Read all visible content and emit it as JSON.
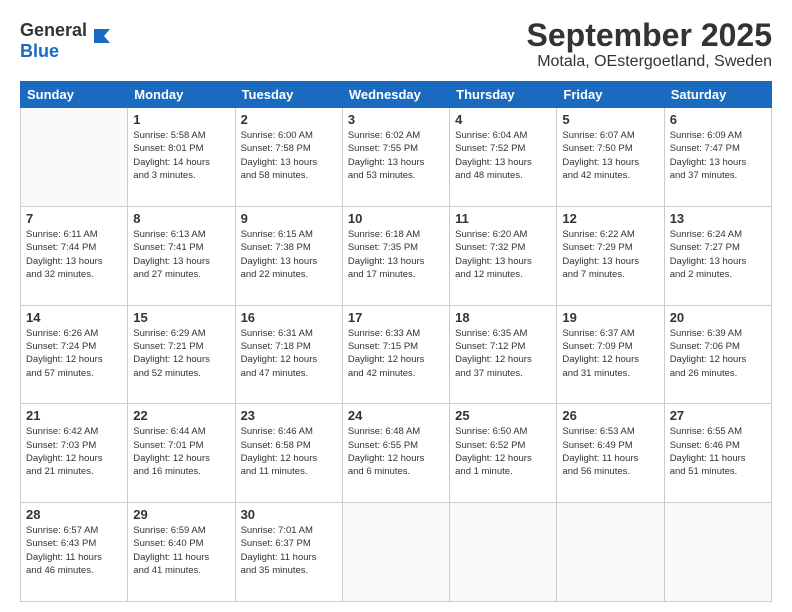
{
  "header": {
    "logo_general": "General",
    "logo_blue": "Blue",
    "title": "September 2025",
    "subtitle": "Motala, OEstergoetland, Sweden"
  },
  "days_of_week": [
    "Sunday",
    "Monday",
    "Tuesday",
    "Wednesday",
    "Thursday",
    "Friday",
    "Saturday"
  ],
  "weeks": [
    [
      {
        "day": "",
        "info": ""
      },
      {
        "day": "1",
        "info": "Sunrise: 5:58 AM\nSunset: 8:01 PM\nDaylight: 14 hours\nand 3 minutes."
      },
      {
        "day": "2",
        "info": "Sunrise: 6:00 AM\nSunset: 7:58 PM\nDaylight: 13 hours\nand 58 minutes."
      },
      {
        "day": "3",
        "info": "Sunrise: 6:02 AM\nSunset: 7:55 PM\nDaylight: 13 hours\nand 53 minutes."
      },
      {
        "day": "4",
        "info": "Sunrise: 6:04 AM\nSunset: 7:52 PM\nDaylight: 13 hours\nand 48 minutes."
      },
      {
        "day": "5",
        "info": "Sunrise: 6:07 AM\nSunset: 7:50 PM\nDaylight: 13 hours\nand 42 minutes."
      },
      {
        "day": "6",
        "info": "Sunrise: 6:09 AM\nSunset: 7:47 PM\nDaylight: 13 hours\nand 37 minutes."
      }
    ],
    [
      {
        "day": "7",
        "info": "Sunrise: 6:11 AM\nSunset: 7:44 PM\nDaylight: 13 hours\nand 32 minutes."
      },
      {
        "day": "8",
        "info": "Sunrise: 6:13 AM\nSunset: 7:41 PM\nDaylight: 13 hours\nand 27 minutes."
      },
      {
        "day": "9",
        "info": "Sunrise: 6:15 AM\nSunset: 7:38 PM\nDaylight: 13 hours\nand 22 minutes."
      },
      {
        "day": "10",
        "info": "Sunrise: 6:18 AM\nSunset: 7:35 PM\nDaylight: 13 hours\nand 17 minutes."
      },
      {
        "day": "11",
        "info": "Sunrise: 6:20 AM\nSunset: 7:32 PM\nDaylight: 13 hours\nand 12 minutes."
      },
      {
        "day": "12",
        "info": "Sunrise: 6:22 AM\nSunset: 7:29 PM\nDaylight: 13 hours\nand 7 minutes."
      },
      {
        "day": "13",
        "info": "Sunrise: 6:24 AM\nSunset: 7:27 PM\nDaylight: 13 hours\nand 2 minutes."
      }
    ],
    [
      {
        "day": "14",
        "info": "Sunrise: 6:26 AM\nSunset: 7:24 PM\nDaylight: 12 hours\nand 57 minutes."
      },
      {
        "day": "15",
        "info": "Sunrise: 6:29 AM\nSunset: 7:21 PM\nDaylight: 12 hours\nand 52 minutes."
      },
      {
        "day": "16",
        "info": "Sunrise: 6:31 AM\nSunset: 7:18 PM\nDaylight: 12 hours\nand 47 minutes."
      },
      {
        "day": "17",
        "info": "Sunrise: 6:33 AM\nSunset: 7:15 PM\nDaylight: 12 hours\nand 42 minutes."
      },
      {
        "day": "18",
        "info": "Sunrise: 6:35 AM\nSunset: 7:12 PM\nDaylight: 12 hours\nand 37 minutes."
      },
      {
        "day": "19",
        "info": "Sunrise: 6:37 AM\nSunset: 7:09 PM\nDaylight: 12 hours\nand 31 minutes."
      },
      {
        "day": "20",
        "info": "Sunrise: 6:39 AM\nSunset: 7:06 PM\nDaylight: 12 hours\nand 26 minutes."
      }
    ],
    [
      {
        "day": "21",
        "info": "Sunrise: 6:42 AM\nSunset: 7:03 PM\nDaylight: 12 hours\nand 21 minutes."
      },
      {
        "day": "22",
        "info": "Sunrise: 6:44 AM\nSunset: 7:01 PM\nDaylight: 12 hours\nand 16 minutes."
      },
      {
        "day": "23",
        "info": "Sunrise: 6:46 AM\nSunset: 6:58 PM\nDaylight: 12 hours\nand 11 minutes."
      },
      {
        "day": "24",
        "info": "Sunrise: 6:48 AM\nSunset: 6:55 PM\nDaylight: 12 hours\nand 6 minutes."
      },
      {
        "day": "25",
        "info": "Sunrise: 6:50 AM\nSunset: 6:52 PM\nDaylight: 12 hours\nand 1 minute."
      },
      {
        "day": "26",
        "info": "Sunrise: 6:53 AM\nSunset: 6:49 PM\nDaylight: 11 hours\nand 56 minutes."
      },
      {
        "day": "27",
        "info": "Sunrise: 6:55 AM\nSunset: 6:46 PM\nDaylight: 11 hours\nand 51 minutes."
      }
    ],
    [
      {
        "day": "28",
        "info": "Sunrise: 6:57 AM\nSunset: 6:43 PM\nDaylight: 11 hours\nand 46 minutes."
      },
      {
        "day": "29",
        "info": "Sunrise: 6:59 AM\nSunset: 6:40 PM\nDaylight: 11 hours\nand 41 minutes."
      },
      {
        "day": "30",
        "info": "Sunrise: 7:01 AM\nSunset: 6:37 PM\nDaylight: 11 hours\nand 35 minutes."
      },
      {
        "day": "",
        "info": ""
      },
      {
        "day": "",
        "info": ""
      },
      {
        "day": "",
        "info": ""
      },
      {
        "day": "",
        "info": ""
      }
    ]
  ]
}
